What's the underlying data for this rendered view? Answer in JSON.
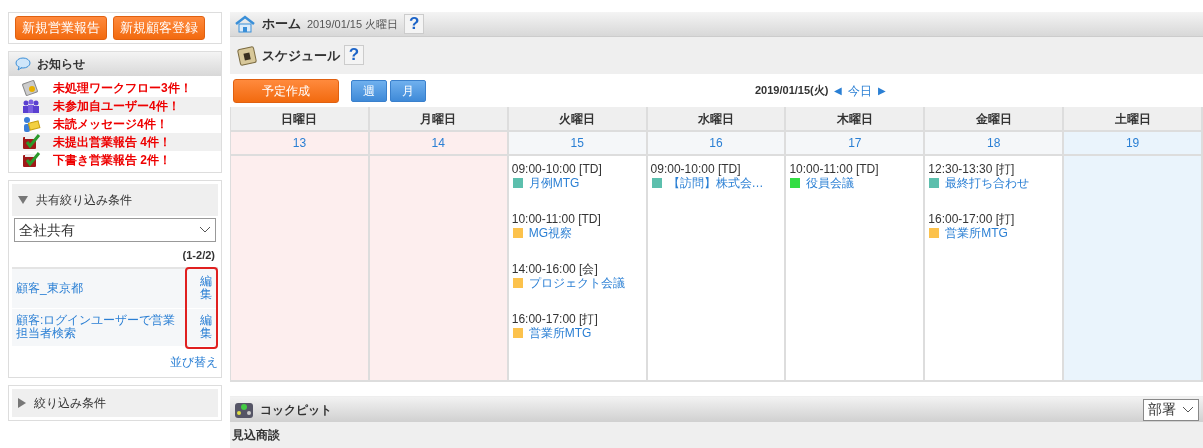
{
  "quick_buttons": [
    "新規営業報告",
    "新規顧客登録"
  ],
  "notices": {
    "title": "お知らせ",
    "items": [
      {
        "kind": "workflow",
        "text": "未処理ワークフロー3件！"
      },
      {
        "kind": "users",
        "text": "未参加自ユーザー4件！"
      },
      {
        "kind": "message",
        "text": "未読メッセージ4件！"
      },
      {
        "kind": "report",
        "text": "未提出営業報告 4件！"
      },
      {
        "kind": "report",
        "text": "下書き営業報告 2件！"
      }
    ]
  },
  "shared_filters": {
    "title": "共有絞り込み条件",
    "expanded": true,
    "scope": "全社共有",
    "count": "(1-2/2)",
    "edit_highlighted": true,
    "rows": [
      {
        "name": "顧客_東京都",
        "edit": "編集"
      },
      {
        "name": "顧客:ログインユーザーで営業担当者検索",
        "edit": "編集"
      }
    ],
    "sort_link": "並び替え"
  },
  "filters": {
    "title": "絞り込み条件",
    "expanded": false
  },
  "home": {
    "title": "ホーム",
    "date": "2019/01/15 火曜日",
    "help": "?"
  },
  "schedule": {
    "title": "スケジュール",
    "help": "?",
    "create_button": "予定作成",
    "views": [
      "週",
      "月"
    ],
    "date": "2019/01/15(火)",
    "prev": "◀",
    "today": "今日",
    "next": "▶",
    "days": [
      {
        "name": "日曜日",
        "date": "13",
        "kind": "holiday"
      },
      {
        "name": "月曜日",
        "date": "14",
        "kind": "holiday"
      },
      {
        "name": "火曜日",
        "date": "15",
        "kind": "weekday",
        "events": [
          {
            "time": "09:00-10:00 [TD]",
            "title": "月例MTG",
            "color": "#5cbfad"
          },
          {
            "time": "10:00-11:00 [TD]",
            "title": "MG視察",
            "color": "#fcc24c"
          },
          {
            "time": "14:00-16:00 [会]",
            "title": "プロジェクト会議",
            "color": "#fcc24c"
          },
          {
            "time": "16:00-17:00 [打]",
            "title": "営業所MTG",
            "color": "#fcc24c"
          }
        ]
      },
      {
        "name": "水曜日",
        "date": "16",
        "kind": "weekday",
        "events": [
          {
            "time": "09:00-10:00 [TD]",
            "title": "【訪問】株式会…",
            "color": "#5cbfad"
          }
        ]
      },
      {
        "name": "木曜日",
        "date": "17",
        "kind": "weekday",
        "events": [
          {
            "time": "10:00-11:00 [TD]",
            "title": "役員会議",
            "color": "#33dd44"
          }
        ]
      },
      {
        "name": "金曜日",
        "date": "18",
        "kind": "weekday",
        "events": [
          {
            "time": "12:30-13:30 [打]",
            "title": "最終打ち合わせ",
            "color": "#5cbfad"
          },
          {
            "time": "16:00-17:00 [打]",
            "title": "営業所MTG",
            "color": "#fcc24c"
          }
        ]
      },
      {
        "name": "土曜日",
        "date": "19",
        "kind": "saturday"
      }
    ]
  },
  "cockpit": {
    "title": "コックピット",
    "department": "部署",
    "section": "見込商談"
  }
}
